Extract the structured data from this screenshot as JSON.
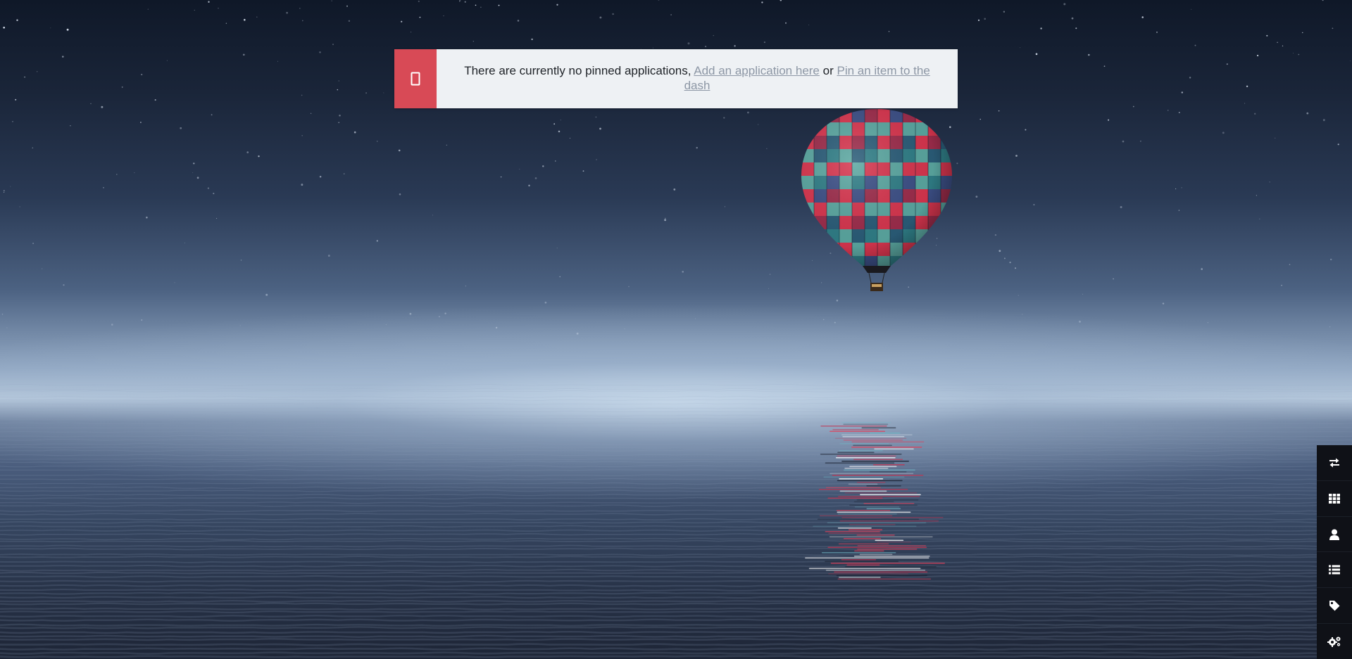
{
  "notification": {
    "icon": "tablet-icon",
    "message_prefix": "There are currently no pinned applications,",
    "link_add_application": "Add an application here",
    "connector": "or",
    "link_pin_item": "Pin an item to the dash",
    "accent_color": "#d84a56"
  },
  "sidebar": {
    "items": [
      {
        "icon": "exchange-arrows-icon"
      },
      {
        "icon": "grid-icon"
      },
      {
        "icon": "user-icon"
      },
      {
        "icon": "list-icon"
      },
      {
        "icon": "tag-icon"
      },
      {
        "icon": "cogs-icon"
      }
    ]
  }
}
